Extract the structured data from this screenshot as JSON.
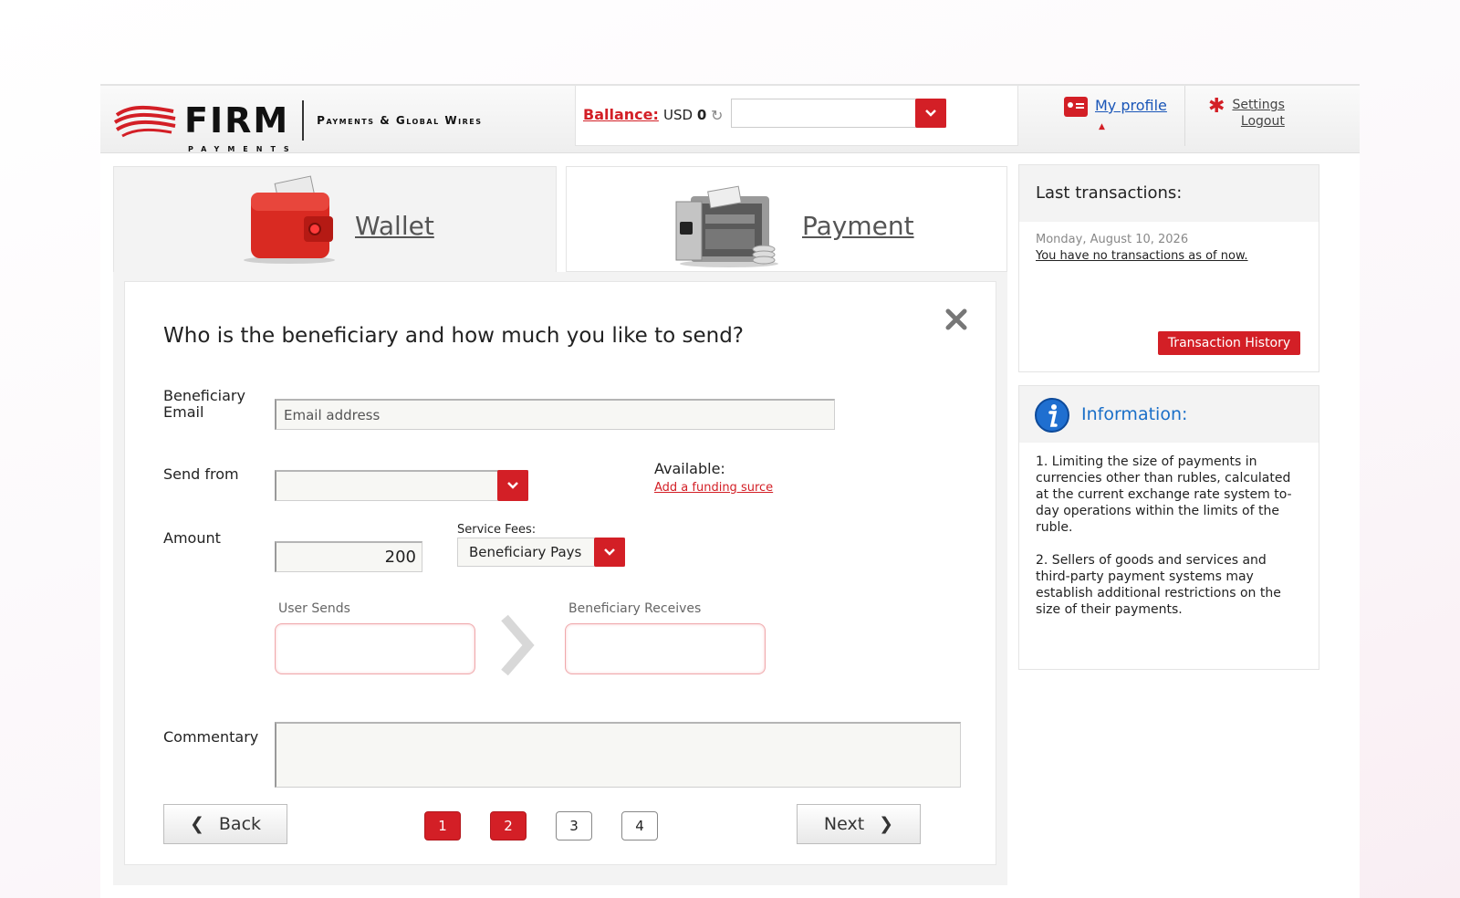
{
  "header": {
    "logo_text": "FIRM",
    "logo_subtext": "PAYMENTS",
    "tagline": "Payments & Global Wires",
    "balance_label": "Ballance:",
    "balance_currency": "USD",
    "balance_amount": "0",
    "profile_link": "My profile",
    "settings_link": "Settings",
    "logout_link": "Logout"
  },
  "tabs": {
    "wallet": "Wallet",
    "payment": "Payment"
  },
  "form": {
    "title": "Who is the beneficiary and how much you like to send?",
    "beneficiary_label_1": "Beneficiary",
    "beneficiary_label_2": "Email",
    "email_placeholder": "Email address",
    "send_from_label": "Send from",
    "available_label": "Available:",
    "add_funding_link": "Add a funding surce",
    "amount_label": "Amount",
    "amount_value": "200",
    "service_fees_label": "Service Fees:",
    "service_fees_value": "Beneficiary Pays",
    "user_sends_label": "User Sends",
    "beneficiary_receives_label": "Beneficiary Receives",
    "commentary_label": "Commentary",
    "back_label": "Back",
    "next_label": "Next",
    "steps": [
      "1",
      "2",
      "3",
      "4"
    ]
  },
  "last_transactions": {
    "title": "Last transactions:",
    "date": "Monday, August 10, 2026",
    "empty_text": "You have no transactions as of now.",
    "history_button": "Transaction History"
  },
  "information": {
    "title": "Information:",
    "item_1": "1. Limiting the size of payments in currencies other than rubles, calculated at the current exchange rate system to-day operations within the limits of the ruble.",
    "item_2": "2. Sellers of goods and services and third-party payment systems may establish additional restrictions on the size of their payments."
  },
  "colors": {
    "accent": "#d31f26",
    "link_blue": "#1a56b8",
    "info_blue": "#1a6fc8"
  },
  "icons": [
    "wave-logo-icon",
    "refresh-icon",
    "chevron-down-icon",
    "profile-card-icon",
    "tools-icon",
    "wallet-icon",
    "safe-icon",
    "close-icon",
    "chevron-left-icon",
    "chevron-right-icon",
    "info-icon"
  ]
}
